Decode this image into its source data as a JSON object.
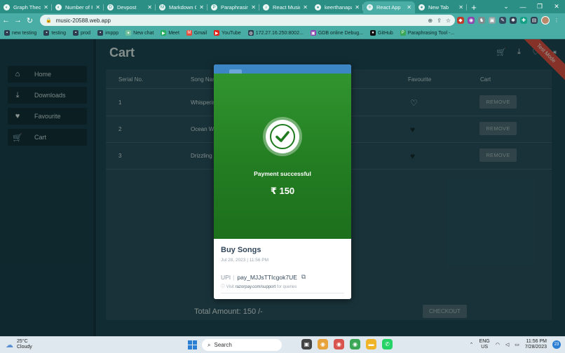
{
  "browser": {
    "tabs": [
      {
        "title": "Graph Theory",
        "icon": "graph-icon"
      },
      {
        "title": "Number of Pr",
        "icon": "problem-icon"
      },
      {
        "title": "Devpost",
        "icon": "devpost-icon"
      },
      {
        "title": "Markdown Ch",
        "icon": "markdown-icon"
      },
      {
        "title": "Paraphrasing",
        "icon": "paraphrase-icon"
      },
      {
        "title": "React Music",
        "icon": "music-icon"
      },
      {
        "title": "keerthanapab",
        "icon": "github-icon"
      },
      {
        "title": "React App",
        "icon": "react-icon",
        "active": true
      },
      {
        "title": "New Tab",
        "icon": "newtab-icon"
      }
    ],
    "url": "music-20588.web.app",
    "bookmarks": [
      {
        "label": "new testing"
      },
      {
        "label": "testing"
      },
      {
        "label": "prod"
      },
      {
        "label": "imppp"
      },
      {
        "label": "New chat"
      },
      {
        "label": "Meet"
      },
      {
        "label": "Gmail"
      },
      {
        "label": "YouTube"
      },
      {
        "label": "172.27.16.250:8002..."
      },
      {
        "label": "GDB online Debug..."
      },
      {
        "label": "GitHub"
      },
      {
        "label": "Paraphrasing Tool -..."
      }
    ]
  },
  "sidebar": {
    "items": [
      {
        "label": "Home",
        "icon": "home-icon"
      },
      {
        "label": "Downloads",
        "icon": "download-icon"
      },
      {
        "label": "Favourite",
        "icon": "heart-icon"
      },
      {
        "label": "Cart",
        "icon": "cart-icon"
      }
    ]
  },
  "main": {
    "title": "Cart",
    "ribbon": "Test Mode",
    "columns": [
      "Serial No.",
      "Song Name",
      "Favourite",
      "Cart"
    ],
    "rows": [
      {
        "serial": "1",
        "song": "Whisperin",
        "favourite": false,
        "action": "REMOVE"
      },
      {
        "serial": "2",
        "song": "Ocean Wa",
        "favourite": true,
        "action": "REMOVE"
      },
      {
        "serial": "3",
        "song": "Drizzling",
        "favourite": true,
        "action": "REMOVE"
      }
    ],
    "total": "Total Amount: 150 /-",
    "checkout_label": "CHECKOUT"
  },
  "modal": {
    "status": "Payment successful",
    "amount": "₹ 150",
    "merchant": "Buy Songs",
    "date": "Jul 28, 2023 | 11:56 PM",
    "upi_label": "UPI",
    "payment_id": "pay_MJJsTTIcgok7UE",
    "visit_prefix": "Visit",
    "support_link": "razorpay.com/support",
    "visit_suffix": "for queries",
    "colors": {
      "success_green": "#2a8a28",
      "header_blue": "#3d86c6"
    }
  },
  "taskbar": {
    "temp": "25°C",
    "condition": "Cloudy",
    "search_placeholder": "Search",
    "lang_top": "ENG",
    "lang_bottom": "US",
    "time": "11:56 PM",
    "date": "7/28/2023",
    "notifications": "23"
  }
}
